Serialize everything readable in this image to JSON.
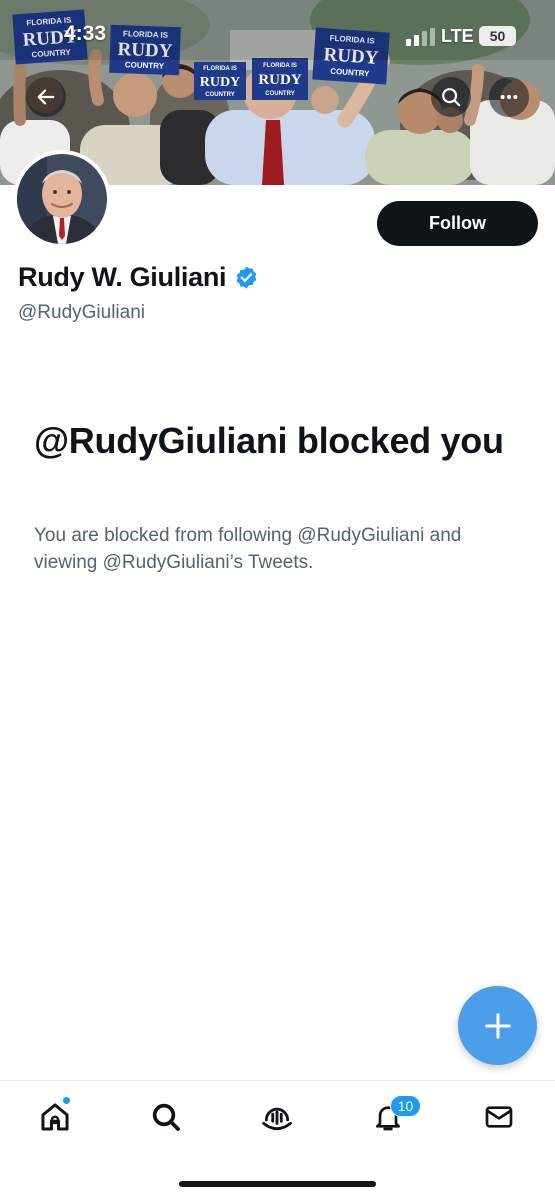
{
  "status_bar": {
    "time": "4:33",
    "carrier": "LTE",
    "battery": "50"
  },
  "profile": {
    "display_name": "Rudy W. Giuliani",
    "handle": "@RudyGiuliani",
    "verified": true,
    "follow_label": "Follow"
  },
  "banner": {
    "signs": [
      {
        "top": "FLORIDA IS",
        "main": "RUDY",
        "bottom": "COUNTRY"
      },
      {
        "top": "FLORIDA IS",
        "main": "RUDY",
        "bottom": "COUNTRY"
      },
      {
        "top": "FLORIDA IS",
        "main": "RUDY",
        "bottom": "COUNTRY"
      },
      {
        "top": "FLORIDA IS",
        "main": "RUDY",
        "bottom": "COUNTRY"
      },
      {
        "top": "FLORIDA IS",
        "main": "RUDY",
        "bottom": "COUNTRY"
      }
    ]
  },
  "blocked": {
    "title": "@RudyGiuliani blocked you",
    "description": "You are blocked from following @RudyGiuliani and viewing @RudyGiuliani’s Tweets."
  },
  "nav": {
    "notifications_badge": "10",
    "items": [
      "home-icon",
      "search-icon",
      "spaces-icon",
      "bell-icon",
      "mail-icon"
    ]
  },
  "colors": {
    "text_primary": "#0f1419",
    "text_secondary": "#536471",
    "accent": "#1d9bf0",
    "fab": "#4b9fe8",
    "follow_button": "#0f1419"
  }
}
